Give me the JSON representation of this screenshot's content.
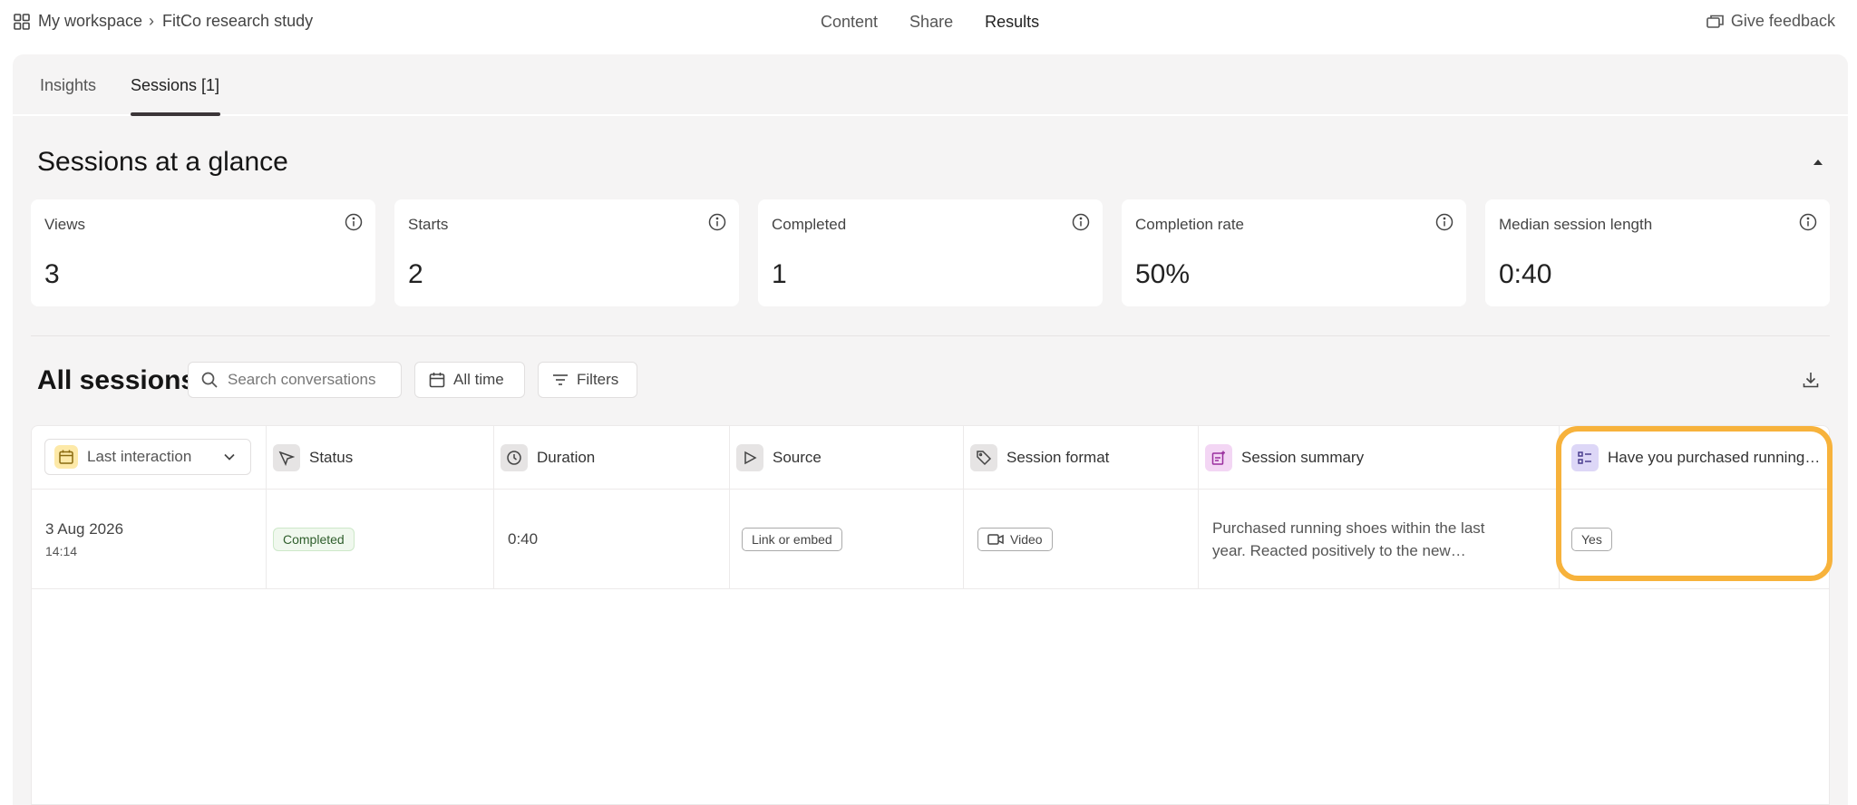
{
  "breadcrumb": {
    "workspace": "My workspace",
    "separator": "›",
    "project": "FitCo research study"
  },
  "top_nav": {
    "content": "Content",
    "share": "Share",
    "results": "Results"
  },
  "feedback_label": "Give feedback",
  "tabs": {
    "insights": "Insights",
    "sessions": "Sessions [1]"
  },
  "glance": {
    "title": "Sessions at a glance",
    "stats": [
      {
        "label": "Views",
        "value": "3"
      },
      {
        "label": "Starts",
        "value": "2"
      },
      {
        "label": "Completed",
        "value": "1"
      },
      {
        "label": "Completion rate",
        "value": "50%"
      },
      {
        "label": "Median session length",
        "value": "0:40"
      }
    ]
  },
  "sessions": {
    "title": "All sessions",
    "search_placeholder": "Search conversations",
    "time_filter": "All time",
    "filters_label": "Filters"
  },
  "table": {
    "columns": {
      "last_interaction": "Last interaction",
      "status": "Status",
      "duration": "Duration",
      "source": "Source",
      "session_format": "Session format",
      "session_summary": "Session summary",
      "question": "Have you purchased running…"
    },
    "rows": [
      {
        "date": "3 Aug 2026",
        "time": "14:14",
        "status": "Completed",
        "duration": "0:40",
        "source": "Link or embed",
        "format": "Video",
        "summary": "Purchased running shoes within the last year. Reacted positively to the new…",
        "answer": "Yes"
      }
    ]
  },
  "colors": {
    "highlight": "#f7b23b",
    "panel_bg": "#f5f4f4",
    "completed_chip_bg": "#f0f8ee",
    "completed_chip_text": "#2f5e2c",
    "tab_underline": "#3b3538"
  }
}
